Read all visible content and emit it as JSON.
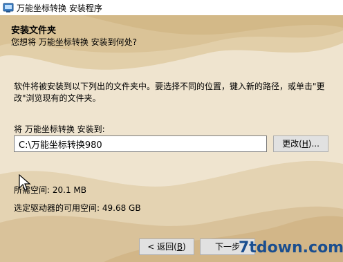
{
  "window": {
    "title": "万能坐标转换 安装程序"
  },
  "header": {
    "title": "安装文件夹",
    "subtitle": "您想将 万能坐标转换 安装到何处?"
  },
  "body": {
    "description": "软件将被安装到以下列出的文件夹中。要选择不同的位置，键入新的路径，或单击\"更改\"浏览现有的文件夹。",
    "dest_label": "将 万能坐标转换 安装到:",
    "dest_path": "C:\\万能坐标转换980",
    "change_pre": "更改(",
    "change_key": "H",
    "change_post": ")...",
    "required_space": "所需空间: 20.1 MB",
    "available_space": "选定驱动器的可用空间: 49.68 GB"
  },
  "footer": {
    "back_pre": "< 返回(",
    "back_key": "B",
    "back_post": ")",
    "next_label": "下一步"
  },
  "watermark": {
    "text": "7tdown.com"
  },
  "colors": {
    "background": "#eadcc3",
    "sand_dark": "#d9c19a",
    "button": "#e1e1e1"
  }
}
